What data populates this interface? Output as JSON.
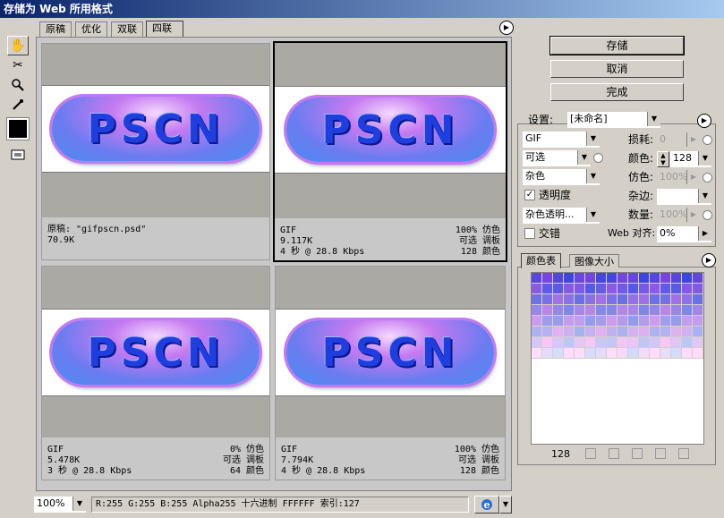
{
  "window": {
    "title": "存储为 Web 所用格式"
  },
  "tabs": [
    {
      "label": "原稿"
    },
    {
      "label": "优化"
    },
    {
      "label": "双联"
    },
    {
      "label": "四联",
      "active": true
    }
  ],
  "preview_text": "PSCN",
  "panes": [
    {
      "line1_left": "原稿: \"gifpscn.psd\"",
      "line2_left": "70.9K",
      "line3_left": "",
      "line1_right": "",
      "line2_right": "",
      "line3_right": ""
    },
    {
      "line1_left": "GIF",
      "line2_left": "9.117K",
      "line3_left": "4 秒 @ 28.8 Kbps",
      "line1_right": "100% 仿色",
      "line2_right": "可选 调板",
      "line3_right": "128 颜色",
      "selected": true
    },
    {
      "line1_left": "GIF",
      "line2_left": "5.478K",
      "line3_left": "3 秒 @ 28.8 Kbps",
      "line1_right": "0% 仿色",
      "line2_right": "可选 调板",
      "line3_right": "64 颜色"
    },
    {
      "line1_left": "GIF",
      "line2_left": "7.794K",
      "line3_left": "4 秒 @ 28.8 Kbps",
      "line1_right": "100% 仿色",
      "line2_right": "可选 调板",
      "line3_right": "128 颜色"
    }
  ],
  "buttons": {
    "save": "存储",
    "cancel": "取消",
    "done": "完成"
  },
  "settings": {
    "label": "设置:",
    "preset": "[未命名]",
    "format": "GIF",
    "reduction": "可选",
    "dither_algo": "杂色",
    "transparency_label": "透明度",
    "transparency_checked": true,
    "transparency_dither": "杂色透明...",
    "interlace_label": "交错",
    "interlace_checked": false,
    "lossy_label": "损耗:",
    "lossy_value": "0",
    "colors_label": "颜色:",
    "colors_value": "128",
    "dither_label": "仿色:",
    "dither_value": "100%",
    "matte_label": "杂边:",
    "matte_value": "",
    "amount_label": "数量:",
    "amount_value": "100%",
    "web_snap_label": "Web 对齐:",
    "web_snap_value": "0%"
  },
  "color_table": {
    "tab_label": "颜色表",
    "image_size_tab": "图像大小",
    "count": "128"
  },
  "statusbar": {
    "zoom": "100%",
    "info": "R:255 G:255 B:255 Alpha255 十六进制   FFFFFF 索引:127"
  },
  "icons": [
    "hand-icon",
    "slice-select-icon",
    "zoom-icon",
    "eyedropper-icon",
    "color-swatch-icon",
    "toggle-slices-icon",
    "browser-preview-icon"
  ]
}
